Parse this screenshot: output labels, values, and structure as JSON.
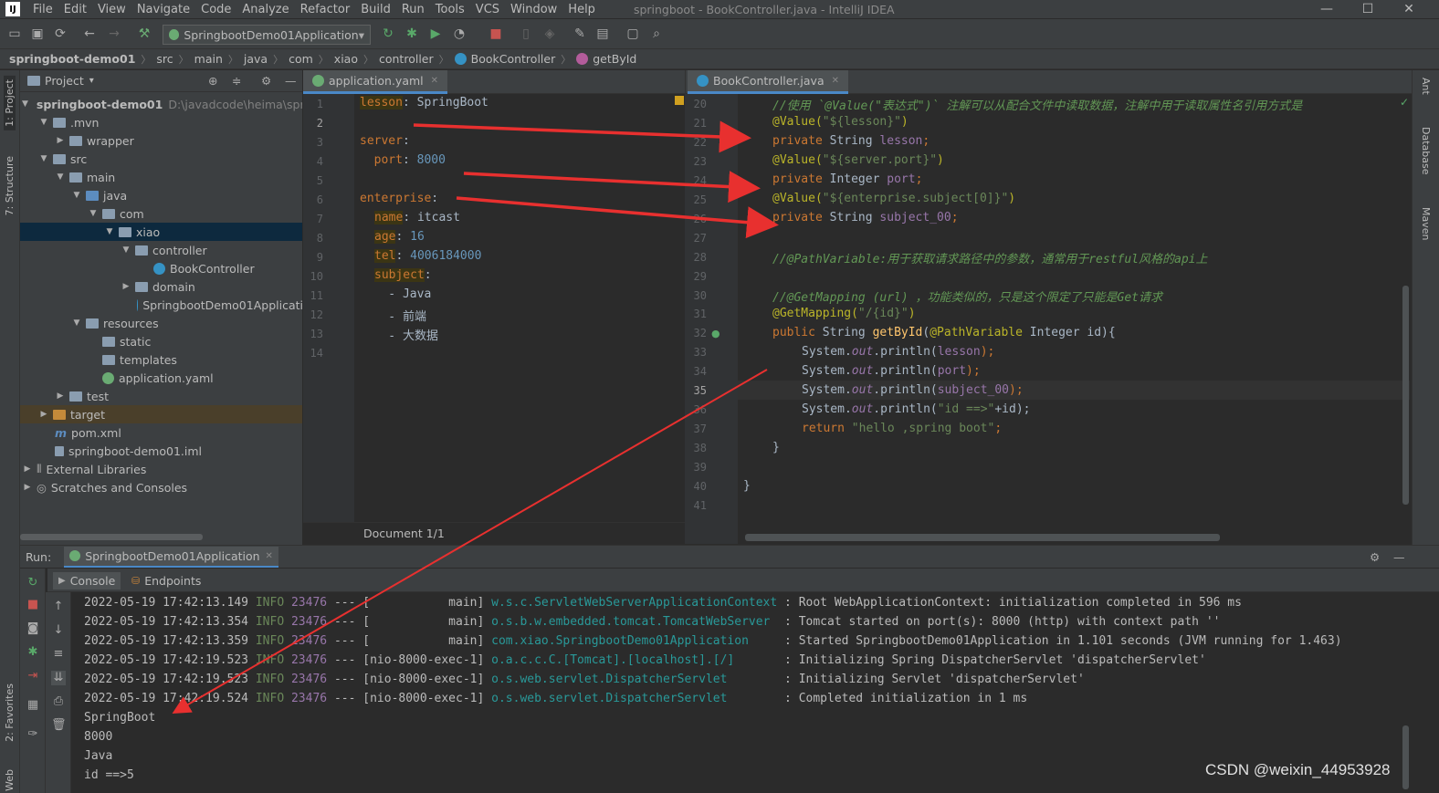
{
  "titlebar": {
    "logo": "IJ",
    "menu": [
      "File",
      "Edit",
      "View",
      "Navigate",
      "Code",
      "Analyze",
      "Refactor",
      "Build",
      "Run",
      "Tools",
      "VCS",
      "Window",
      "Help"
    ],
    "title": "springboot - BookController.java - IntelliJ IDEA",
    "minimize": "—",
    "maximize": "☐",
    "close": "✕"
  },
  "toolbar": {
    "run_config": "SpringbootDemo01Application",
    "dropdown": "▾"
  },
  "breadcrumb": [
    "springboot-demo01",
    "src",
    "main",
    "java",
    "com",
    "xiao",
    "controller",
    "BookController",
    "getById"
  ],
  "left_strip": {
    "project_tab": "1: Project",
    "structure_tab": "7: Structure",
    "favorites_tab": "2: Favorites",
    "web_tab": "Web"
  },
  "right_strip": {
    "ant": "Ant",
    "database": "Database",
    "maven": "Maven"
  },
  "project": {
    "header": "Project",
    "tree": [
      {
        "label": "springboot-demo01",
        "extra": "D:\\javadcode\\heima\\spri"
      },
      {
        "label": ".mvn"
      },
      {
        "label": "wrapper"
      },
      {
        "label": "src"
      },
      {
        "label": "main"
      },
      {
        "label": "java"
      },
      {
        "label": "com"
      },
      {
        "label": "xiao"
      },
      {
        "label": "controller"
      },
      {
        "label": "BookController"
      },
      {
        "label": "domain"
      },
      {
        "label": "SpringbootDemo01Applicati"
      },
      {
        "label": "resources"
      },
      {
        "label": "static"
      },
      {
        "label": "templates"
      },
      {
        "label": "application.yaml"
      },
      {
        "label": "test"
      },
      {
        "label": "target"
      },
      {
        "label": "pom.xml"
      },
      {
        "label": "springboot-demo01.iml"
      },
      {
        "label": "External Libraries"
      },
      {
        "label": "Scratches and Consoles"
      }
    ]
  },
  "yaml_editor": {
    "tab": "application.yaml",
    "status": "Document 1/1",
    "line_numbers": [
      "1",
      "2",
      "3",
      "4",
      "5",
      "6",
      "7",
      "8",
      "9",
      "10",
      "11",
      "12",
      "13",
      "14"
    ],
    "lines": {
      "l1_key": "lesson",
      "l1_val": ": SpringBoot",
      "l3_key": "server",
      "l3_val": ":",
      "l4_key": "  port",
      "l4_sep": ": ",
      "l4_val": "8000",
      "l6_key": "enterprise",
      "l6_val": ":",
      "l7_key": "name",
      "l7_val": ": itcast",
      "l8_key": "age",
      "l8_sep": ": ",
      "l8_val": "16",
      "l9_key": "tel",
      "l9_sep": ": ",
      "l9_val": "4006184000",
      "l10_key": "subject",
      "l10_val": ":",
      "l11": "    - Java",
      "l12": "    - 前端",
      "l13": "    - 大数据"
    }
  },
  "java_editor": {
    "tab": "BookController.java",
    "line_numbers": [
      "20",
      "21",
      "22",
      "23",
      "24",
      "25",
      "26",
      "27",
      "28",
      "29",
      "30",
      "31",
      "32",
      "33",
      "34",
      "35",
      "36",
      "37",
      "38",
      "39",
      "40",
      "41"
    ],
    "l20": "//使用 `@Value(\"表达式\")` 注解可以从配合文件中读取数据，注解中用于读取属性名引用方式是",
    "l21_ann": "@Value(",
    "l21_str": "\"${lesson}\"",
    "l21_end": ")",
    "l22_kw": "private ",
    "l22_type": "String ",
    "l22_fld": "lesson",
    "l22_end": ";",
    "l23_ann": "@Value(",
    "l23_str": "\"${server.port}\"",
    "l23_end": ")",
    "l24_kw": "private ",
    "l24_type": "Integer ",
    "l24_fld": "port",
    "l24_end": ";",
    "l25_ann": "@Value(",
    "l25_str": "\"${enterprise.subject[0]}\"",
    "l25_end": ")",
    "l26_kw": "private ",
    "l26_type": "String ",
    "l26_fld": "subject_00",
    "l26_end": ";",
    "l28": "//@PathVariable:用于获取请求路径中的参数，通常用于restful风格的api上",
    "l30": "//@GetMapping (url) ，功能类似的，只是这个限定了只能是Get请求",
    "l31_ann": "@GetMapping(",
    "l31_str": "\"/{id}\"",
    "l31_end": ")",
    "l32_kw": "public ",
    "l32_type": "String ",
    "l32_fn": "getById",
    "l32_p1": "(",
    "l32_ann": "@PathVariable",
    "l32_p2": " Integer id){",
    "l33_a": "System.",
    "l33_b": "out",
    "l33_c": ".println(",
    "l33_d": "lesson",
    "l33_e": ");",
    "l34_a": "System.",
    "l34_b": "out",
    "l34_c": ".println(",
    "l34_d": "port",
    "l34_e": ");",
    "l35_a": "System.",
    "l35_b": "out",
    "l35_c": ".println(",
    "l35_d": "subject_00",
    "l35_e": ");",
    "l36_a": "System.",
    "l36_b": "out",
    "l36_c": ".println(",
    "l36_d": "\"id ==>\"",
    "l36_e": "+id);",
    "l37_kw": "return ",
    "l37_str": "\"hello ,spring boot\"",
    "l37_end": ";",
    "l38": "}",
    "l40": "}"
  },
  "run_panel": {
    "label": "Run:",
    "tab": "SpringbootDemo01Application",
    "console_tab": "Console",
    "endpoints_tab": "Endpoints",
    "log": [
      {
        "ts": "2022-05-19 17:42:13.149",
        "level": "INFO",
        "pid": "23476",
        "sep": " --- [           main] ",
        "logger": "w.s.c.ServletWebServerApplicationContext",
        "msg": " : Root WebApplicationContext: initialization completed in 596 ms"
      },
      {
        "ts": "2022-05-19 17:42:13.354",
        "level": "INFO",
        "pid": "23476",
        "sep": " --- [           main] ",
        "logger": "o.s.b.w.embedded.tomcat.TomcatWebServer ",
        "msg": " : Tomcat started on port(s): 8000 (http) with context path ''"
      },
      {
        "ts": "2022-05-19 17:42:13.359",
        "level": "INFO",
        "pid": "23476",
        "sep": " --- [           main] ",
        "logger": "com.xiao.SpringbootDemo01Application    ",
        "msg": " : Started SpringbootDemo01Application in 1.101 seconds (JVM running for 1.463)"
      },
      {
        "ts": "2022-05-19 17:42:19.523",
        "level": "INFO",
        "pid": "23476",
        "sep": " --- [nio-8000-exec-1] ",
        "logger": "o.a.c.c.C.[Tomcat].[localhost].[/]      ",
        "msg": " : Initializing Spring DispatcherServlet 'dispatcherServlet'"
      },
      {
        "ts": "2022-05-19 17:42:19.523",
        "level": "INFO",
        "pid": "23476",
        "sep": " --- [nio-8000-exec-1] ",
        "logger": "o.s.web.servlet.DispatcherServlet       ",
        "msg": " : Initializing Servlet 'dispatcherServlet'"
      },
      {
        "ts": "2022-05-19 17:42:19.524",
        "level": "INFO",
        "pid": "23476",
        "sep": " --- [nio-8000-exec-1] ",
        "logger": "o.s.web.servlet.DispatcherServlet       ",
        "msg": " : Completed initialization in 1 ms"
      }
    ],
    "output": [
      "SpringBoot",
      "8000",
      "Java",
      "id ==>5"
    ]
  },
  "watermark": "CSDN @weixin_44953928",
  "colors": {
    "annotation_arrow": "#e8302f"
  }
}
